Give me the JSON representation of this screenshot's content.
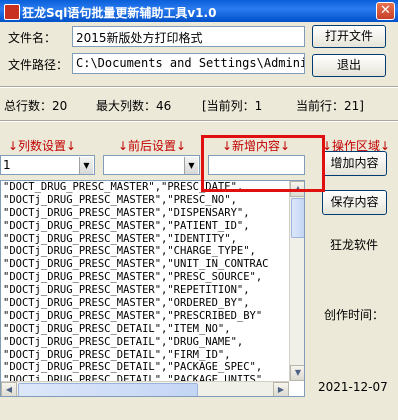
{
  "window": {
    "title": "狂龙Sql语句批量更新辅助工具v1.0",
    "close": "✕"
  },
  "form": {
    "filename_label": "文件名：",
    "filename_value": "2015新版处方打印格式",
    "filepath_label": "文件路径：",
    "filepath_value": "C:\\Documents and Settings\\Adminis"
  },
  "buttons": {
    "open_file": "打开文件",
    "exit": "退出",
    "add_content": "增加内容",
    "save_content": "保存内容"
  },
  "stats": {
    "total_rows": "总行数：20",
    "max_columns": "最大列数：46",
    "current_column": "[当前列：1",
    "current_row": "当前行：21]"
  },
  "section_headers": {
    "column_settings": "↓列数设置↓",
    "before_after": "↓前后设置↓",
    "new_content": "↓新增内容↓",
    "operation_area": "↓操作区域↓"
  },
  "controls": {
    "column_combo_value": "1",
    "before_after_combo_value": "",
    "new_content_value": ""
  },
  "side_info": {
    "author": "狂龙软件",
    "created_label": "创作时间：",
    "created_date": "2021-12-07"
  },
  "list_rows": [
    "\"DOCT_DRUG_PRESC_MASTER\",\"PRESC_DATE\",",
    "\"DOCTj_DRUG_PRESC_MASTER\",\"PRESC_NO\",",
    "\"DOCTj_DRUG_PRESC_MASTER\",\"DISPENSARY\",",
    "\"DOCTj_DRUG_PRESC_MASTER\",\"PATIENT_ID\",",
    "\"DOCTj_DRUG_PRESC_MASTER\",\"IDENTITY\",",
    "\"DOCTj_DRUG_PRESC_MASTER\",\"CHARGE_TYPE\",",
    "\"DOCTj_DRUG_PRESC_MASTER\",\"UNIT_IN_CONTRAC",
    "\"DOCTj_DRUG_PRESC_MASTER\",\"PRESC_SOURCE\",",
    "\"DOCTj_DRUG_PRESC_MASTER\",\"REPETITION\",",
    "\"DOCTj_DRUG_PRESC_MASTER\",\"ORDERED_BY\",",
    "\"DOCTj_DRUG_PRESC_MASTER\",\"PRESCRIBED_BY\"",
    "\"DOCTj_DRUG_PRESC_DETAIL\",\"ITEM_NO\",",
    "\"DOCTj_DRUG_PRESC_DETAIL\",\"DRUG_NAME\",",
    "\"DOCTj_DRUG_PRESC_DETAIL\",\"FIRM_ID\",",
    "\"DOCTj_DRUG_PRESC_DETAIL\",\"PACKAGE_SPEC\",",
    "\"DOCTj_DRUG_PRESC_DETAIL\",\"PACKAGE_UNITS\""
  ],
  "colors": {
    "header_red": "#c00000",
    "highlight": "#e01010",
    "titlebar": "#0a5fd8"
  }
}
